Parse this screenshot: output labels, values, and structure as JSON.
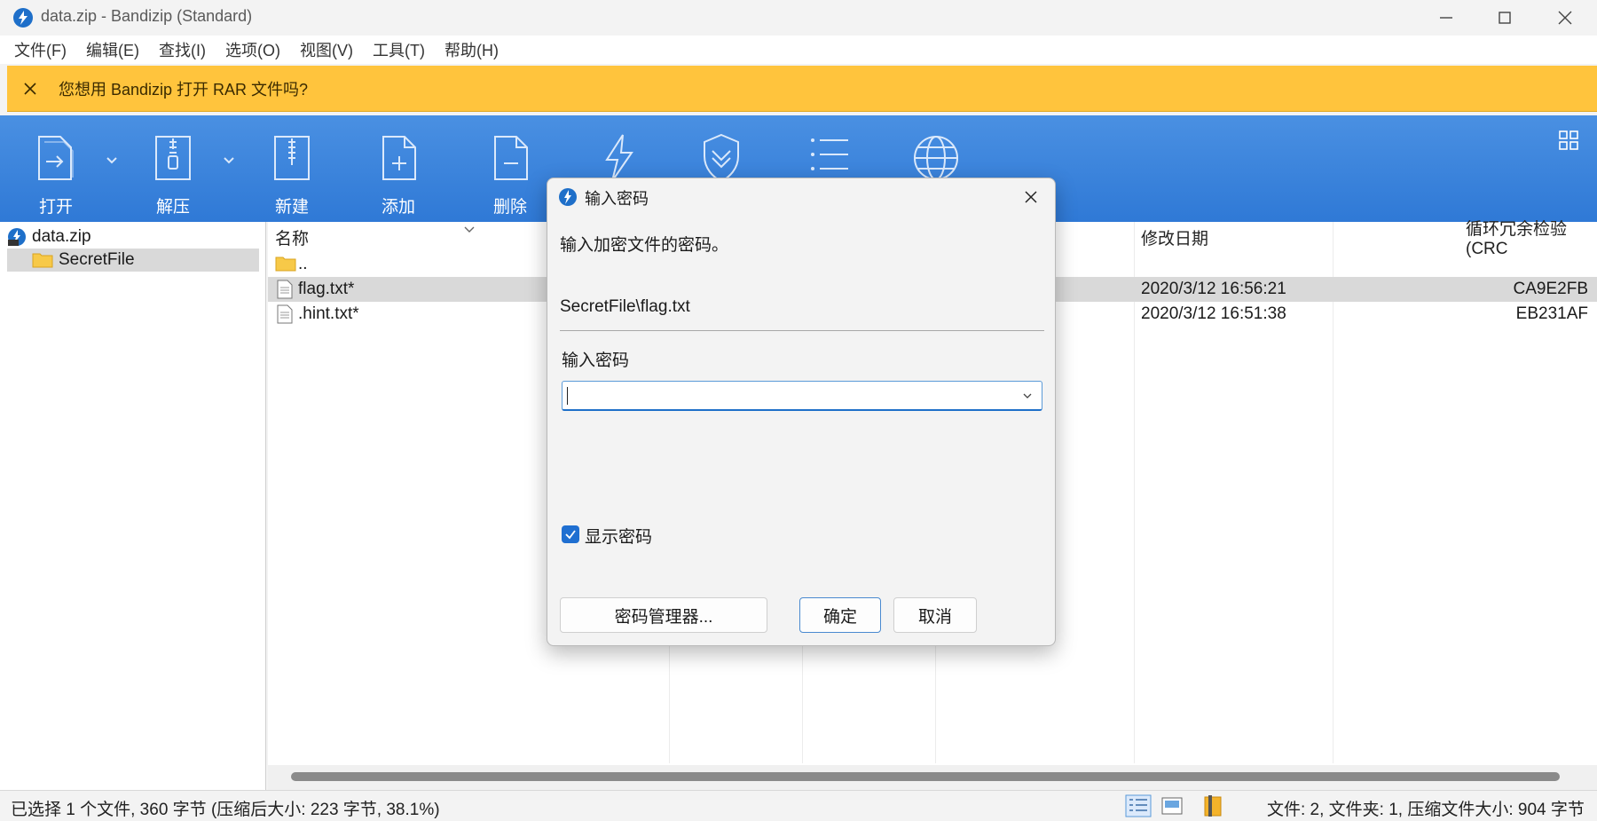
{
  "window": {
    "title": "data.zip - Bandizip (Standard)",
    "icon": "bandizip-logo"
  },
  "menu": [
    "文件(F)",
    "编辑(E)",
    "查找(I)",
    "选项(O)",
    "视图(V)",
    "工具(T)",
    "帮助(H)"
  ],
  "banner": {
    "text": "您想用 Bandizip 打开 RAR 文件吗?",
    "color": "#ffc43d"
  },
  "toolbar": {
    "color": "#3583dc",
    "open": "打开",
    "extract": "解压",
    "new": "新建",
    "add": "添加",
    "delete": "删除"
  },
  "tree": {
    "root": "data.zip",
    "folder": "SecretFile"
  },
  "filelist": {
    "columns": {
      "name": "名称",
      "modified": "修改日期",
      "crc": "循环冗余检验 (CRC"
    },
    "parent": "..",
    "rows": [
      {
        "name": "flag.txt*",
        "modified": "2020/3/12 16:56:21",
        "crc": "CA9E2FB"
      },
      {
        "name": ".hint.txt*",
        "modified": "2020/3/12 16:51:38",
        "crc": "EB231AF"
      }
    ]
  },
  "status": {
    "left": "已选择 1 个文件, 360 字节 (压缩后大小: 223 字节, 38.1%)",
    "right": "文件: 2, 文件夹: 1, 压缩文件大小: 904 字节"
  },
  "dialog": {
    "title": "输入密码",
    "message": "输入加密文件的密码。",
    "file": "SecretFile\\flag.txt",
    "password_label": "输入密码",
    "password_value": "",
    "show_password_label": "显示密码",
    "show_password_checked": true,
    "manager_button": "密码管理器...",
    "ok_button": "确定",
    "cancel_button": "取消",
    "accent": "#1f6fd1"
  }
}
